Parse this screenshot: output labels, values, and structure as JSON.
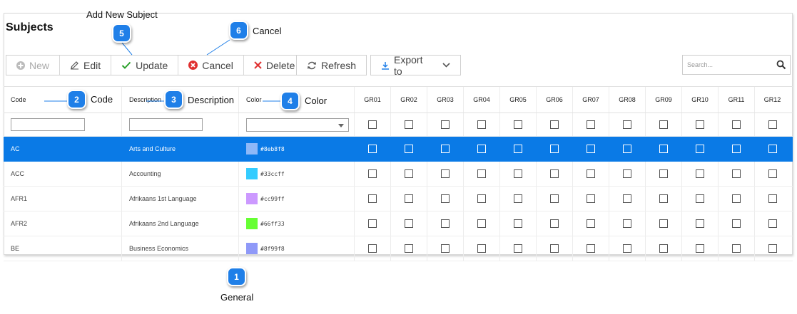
{
  "page": {
    "title": "Subjects"
  },
  "toolbar": {
    "new_label": "New",
    "edit_label": "Edit",
    "update_label": "Update",
    "cancel_label": "Cancel",
    "delete_label": "Delete",
    "refresh_label": "Refresh",
    "export_label": "Export to"
  },
  "search": {
    "placeholder": "Search..."
  },
  "grid": {
    "headers": {
      "code": "Code",
      "description": "Description",
      "color": "Color",
      "grades": [
        "GR01",
        "GR02",
        "GR03",
        "GR04",
        "GR05",
        "GR06",
        "GR07",
        "GR08",
        "GR09",
        "GR10",
        "GR11",
        "GR12"
      ]
    },
    "rows": [
      {
        "code": "AC",
        "description": "Arts and Culture",
        "color": "#8eb8f8",
        "selected": true
      },
      {
        "code": "ACC",
        "description": "Accounting",
        "color": "#33ccff",
        "selected": false
      },
      {
        "code": "AFR1",
        "description": "Afrikaans 1st Language",
        "color": "#cc99ff",
        "selected": false
      },
      {
        "code": "AFR2",
        "description": "Afrikaans 2nd Language",
        "color": "#66ff33",
        "selected": false
      },
      {
        "code": "BE",
        "description": "Business Economics",
        "color": "#8f99f8",
        "selected": false
      }
    ]
  },
  "callouts": {
    "c1": {
      "number": "1",
      "label": "General"
    },
    "c2": {
      "number": "2",
      "label": "Code"
    },
    "c3": {
      "number": "3",
      "label": "Description"
    },
    "c4": {
      "number": "4",
      "label": "Color"
    },
    "c5": {
      "number": "5",
      "label": "Add New Subject"
    },
    "c6": {
      "number": "6",
      "label": "Cancel"
    }
  },
  "colors": {
    "selected_row": "#0a7ae6",
    "badge": "#1f7fe8",
    "ok_green": "#2aa02a",
    "danger_red": "#e03030"
  }
}
